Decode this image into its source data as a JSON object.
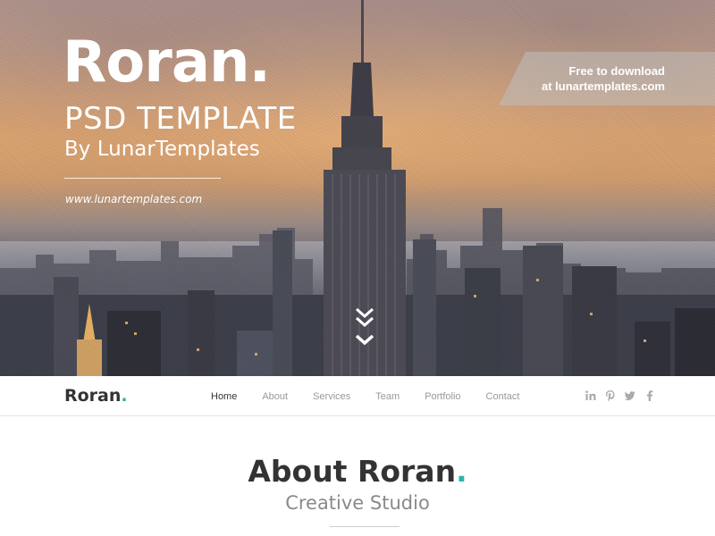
{
  "hero": {
    "brand": "Roran",
    "brand_dot": ".",
    "subtitle": "PSD TEMPLATE",
    "byline": "By LunarTemplates",
    "url": "www.lunartemplates.com",
    "ribbon_line1": "Free to download",
    "ribbon_line2": "at lunartemplates.com",
    "scroll_icon": "chevron-double-down-icon"
  },
  "nav": {
    "logo": "Roran",
    "logo_dot": ".",
    "items": [
      {
        "label": "Home",
        "active": true
      },
      {
        "label": "About",
        "active": false
      },
      {
        "label": "Services",
        "active": false
      },
      {
        "label": "Team",
        "active": false
      },
      {
        "label": "Portfolio",
        "active": false
      },
      {
        "label": "Contact",
        "active": false
      }
    ],
    "social": [
      "linkedin-icon",
      "pinterest-icon",
      "twitter-icon",
      "facebook-icon"
    ]
  },
  "about": {
    "title": "About Roran",
    "title_dot": ".",
    "subtitle": "Creative Studio"
  },
  "colors": {
    "accent": "#2bb5a8",
    "text_dark": "#333333",
    "text_muted": "#999999"
  }
}
